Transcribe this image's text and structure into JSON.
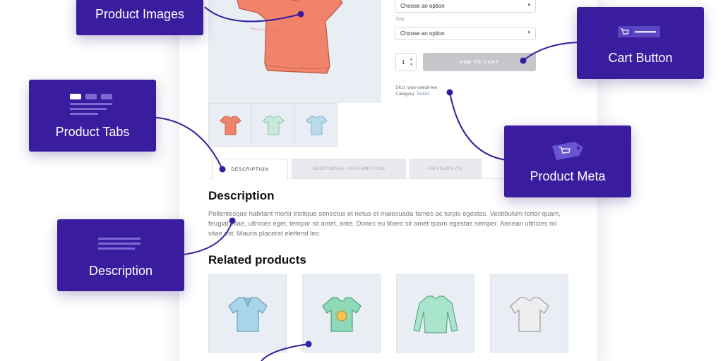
{
  "colors": {
    "callout_bg": "#3a1c9e",
    "connector": "#3a1c9e",
    "button_disabled": "#c4c6c9",
    "link": "#6e88c9"
  },
  "product": {
    "color_select": "Choose an option",
    "size_label": "Size",
    "size_select": "Choose an option",
    "quantity": "1",
    "add_to_cart": "ADD TO CART",
    "sku": "SKU: woo-vneck-tee",
    "category_label": "Category: ",
    "category_value": "Tshirts"
  },
  "tabs": [
    {
      "label": "DESCRIPTION",
      "active": true
    },
    {
      "label": "ADDITIONAL INFORMATION",
      "active": false
    },
    {
      "label": "REVIEWS (0)",
      "active": false
    }
  ],
  "description": {
    "heading": "Description",
    "text": "Pellentesque habitant morbi tristique senectus et netus et malesuada fames ac turpis egestas. Vestibulum tortor quam, feugiat vitae, ultricies eget, tempor sit amet, ante. Donec eu libero sit amet quam egestas semper. Aenean ultricies mi vitae est. Mauris placerat eleifend leo."
  },
  "related": {
    "heading": "Related products"
  },
  "callouts": {
    "product_images": "Product Images",
    "product_tabs": "Product Tabs",
    "description": "Description",
    "cart_button": "Cart Button",
    "product_meta": "Product Meta"
  }
}
